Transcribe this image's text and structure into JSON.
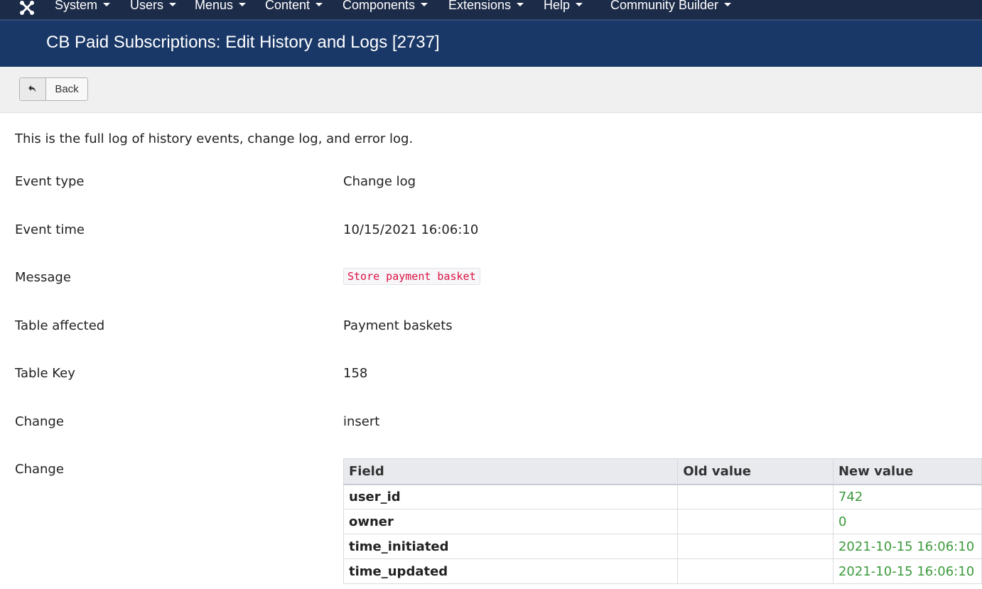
{
  "nav": {
    "items": [
      {
        "label": "System"
      },
      {
        "label": "Users"
      },
      {
        "label": "Menus"
      },
      {
        "label": "Content"
      },
      {
        "label": "Components"
      },
      {
        "label": "Extensions"
      },
      {
        "label": "Help"
      },
      {
        "label": "Community Builder"
      }
    ]
  },
  "header": {
    "title": "CB Paid Subscriptions: Edit History and Logs [2737]"
  },
  "toolbar": {
    "back_label": "Back"
  },
  "content": {
    "intro": "This is the full log of history events, change log, and error log.",
    "fields": {
      "event_type": {
        "label": "Event type",
        "value": "Change log"
      },
      "event_time": {
        "label": "Event time",
        "value": "10/15/2021 16:06:10"
      },
      "message": {
        "label": "Message",
        "value": "Store payment basket"
      },
      "table_affected": {
        "label": "Table affected",
        "value": "Payment baskets"
      },
      "table_key": {
        "label": "Table Key",
        "value": "158"
      },
      "change": {
        "label": "Change",
        "value": "insert"
      },
      "change_details": {
        "label": "Change"
      }
    },
    "table": {
      "headers": {
        "field": "Field",
        "old": "Old value",
        "new": "New value"
      },
      "rows": [
        {
          "field": "user_id",
          "old": "",
          "new": "742"
        },
        {
          "field": "owner",
          "old": "",
          "new": "0"
        },
        {
          "field": "time_initiated",
          "old": "",
          "new": "2021-10-15 16:06:10"
        },
        {
          "field": "time_updated",
          "old": "",
          "new": "2021-10-15 16:06:10"
        }
      ]
    }
  },
  "colors": {
    "nav_bg": "#1c2b48",
    "header_bg": "#1a3867",
    "new_value": "#3c9a3c",
    "code_text": "#d14"
  }
}
